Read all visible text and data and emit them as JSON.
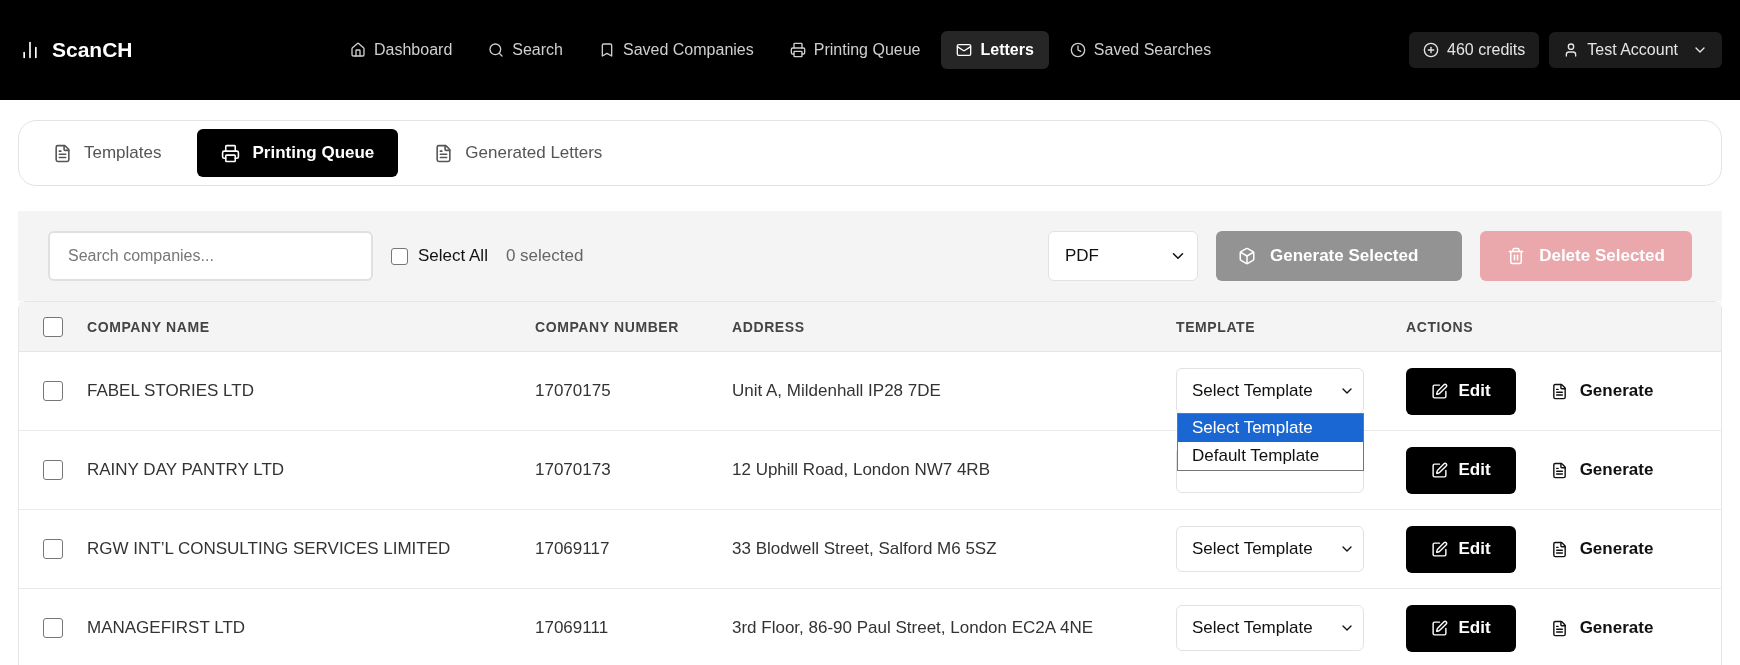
{
  "app": {
    "logo": "ScanCH"
  },
  "nav": [
    {
      "label": "Dashboard",
      "selected": false
    },
    {
      "label": "Search",
      "selected": false
    },
    {
      "label": "Saved Companies",
      "selected": false
    },
    {
      "label": "Printing Queue",
      "selected": false
    },
    {
      "label": "Letters",
      "selected": true
    },
    {
      "label": "Saved Searches",
      "selected": false
    }
  ],
  "credits": "460 credits",
  "account": "Test Account",
  "tabs": [
    {
      "label": "Templates",
      "selected": false
    },
    {
      "label": "Printing Queue",
      "selected": true
    },
    {
      "label": "Generated Letters",
      "selected": false
    }
  ],
  "toolbar": {
    "search": {
      "placeholder": "Search companies..."
    },
    "select_all": {
      "label": "Select All",
      "checked": false
    },
    "selected_count": "0 selected",
    "format": "PDF",
    "generate_button": {
      "label": "Generate Selected",
      "disabled": true
    },
    "delete_button": {
      "label": "Delete Selected",
      "disabled": true
    }
  },
  "table": {
    "columns": [
      "COMPANY NAME",
      "COMPANY NUMBER",
      "ADDRESS",
      "TEMPLATE",
      "ACTIONS"
    ],
    "header_checked": false,
    "rows": [
      {
        "name": "FABEL STORIES LTD",
        "number": "17070175",
        "address": "Unit A, Mildenhall IP28 7DE",
        "template": "Select Template",
        "checked": false,
        "options": [
          {
            "label": "Select Template",
            "selected": true
          },
          {
            "label": "Default Template",
            "selected": false
          }
        ],
        "edit": "Edit",
        "generate": "Generate"
      },
      {
        "name": "RAINY DAY PANTRY LTD",
        "number": "17070173",
        "address": "12 Uphill Road, London NW7 4RB",
        "checked": false,
        "edit": "Edit",
        "generate": "Generate"
      },
      {
        "name": "RGW INT’L CONSULTING SERVICES LIMITED",
        "number": "17069117",
        "address": "33 Blodwell Street, Salford M6 5SZ",
        "template": "Select Template",
        "checked": false,
        "edit": "Edit",
        "generate": "Generate"
      },
      {
        "name": "MANAGEFIRST LTD",
        "number": "17069111",
        "address": "3rd Floor, 86-90 Paul Street, London EC2A 4NE",
        "template": "Select Template",
        "checked": false,
        "edit": "Edit",
        "generate": "Generate"
      }
    ]
  }
}
